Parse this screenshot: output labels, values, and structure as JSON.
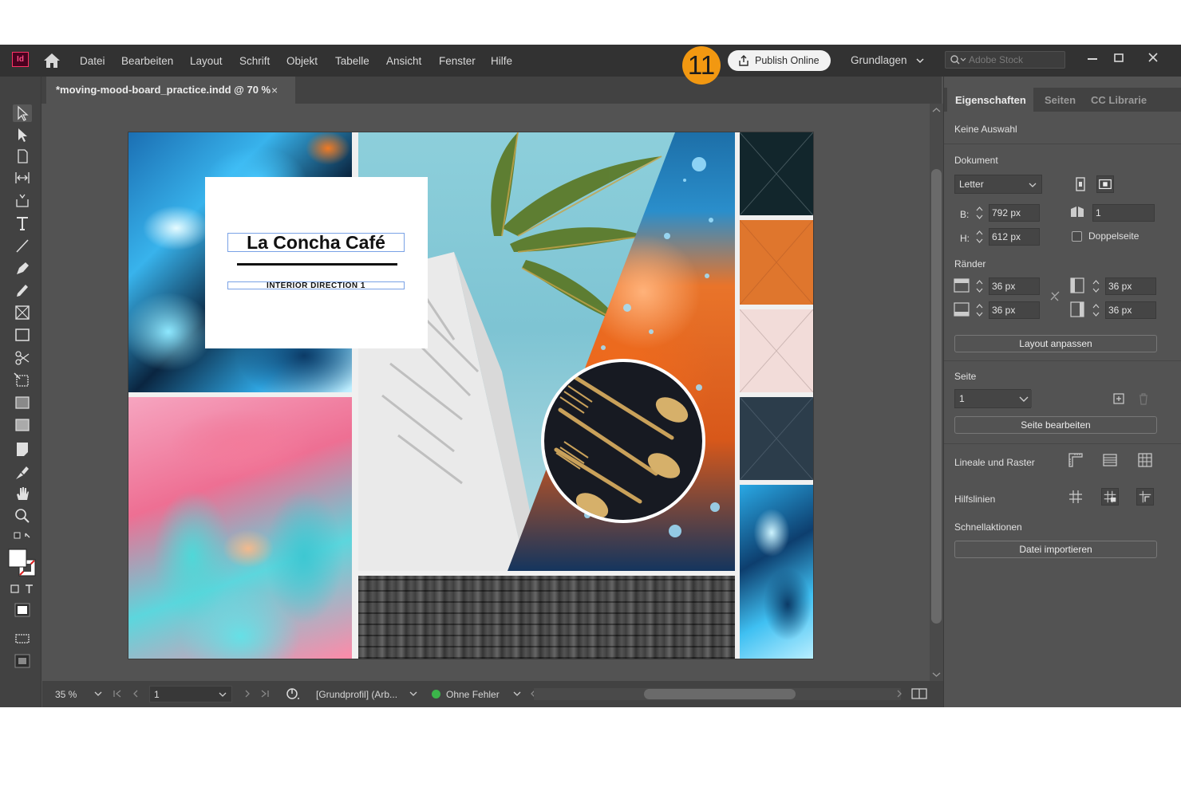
{
  "menubar": {
    "app_icon": "Id",
    "items": [
      "Datei",
      "Bearbeiten",
      "Layout",
      "Schrift",
      "Objekt",
      "Tabelle",
      "Ansicht",
      "Fenster",
      "Hilfe"
    ],
    "step_badge": "11",
    "publish_label": "Publish Online",
    "workspace": "Grundlagen",
    "stock_placeholder": "Adobe Stock"
  },
  "document": {
    "tab_title": "*moving-mood-board_practice.indd @ 70 %",
    "close_glyph": "×",
    "title_text": "La Concha Café",
    "subtitle_text": "INTERIOR DIRECTION 1"
  },
  "statusbar": {
    "zoom": "35 %",
    "page": "1",
    "profile": "[Grundprofil] (Arb...",
    "errors": "Ohne Fehler"
  },
  "panel": {
    "tabs": [
      "Eigenschaften",
      "Seiten",
      "CC Librarie"
    ],
    "selection": "Keine Auswahl",
    "document_heading": "Dokument",
    "page_size": "Letter",
    "width_label": "B:",
    "width_value": "792 px",
    "height_label": "H:",
    "height_value": "612 px",
    "pages_count": "1",
    "facing_pages": "Doppelseite",
    "margins_heading": "Ränder",
    "margin_top": "36 px",
    "margin_bottom": "36 px",
    "margin_left": "36 px",
    "margin_right": "36 px",
    "adjust_layout": "Layout anpassen",
    "page_heading": "Seite",
    "page_value": "1",
    "edit_page": "Seite bearbeiten",
    "rulers_grids": "Lineale und Raster",
    "guides": "Hilfslinien",
    "quick_actions": "Schnellaktionen",
    "import_file": "Datei importieren"
  },
  "colors": {
    "accent_badge": "#f29811",
    "app_bg": "#535353",
    "menubar_bg": "#323232",
    "indesign_pink": "#ff3366"
  }
}
